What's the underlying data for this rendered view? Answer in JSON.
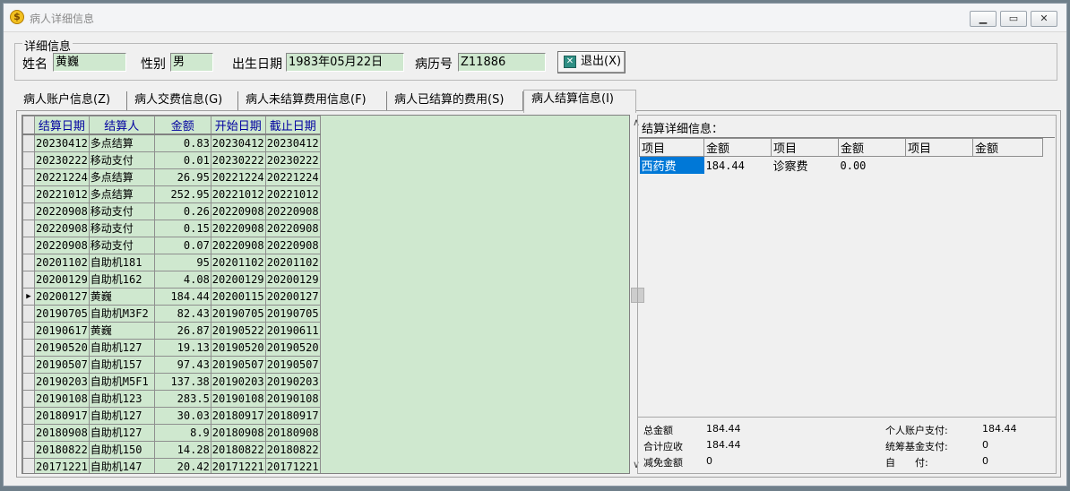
{
  "window": {
    "title": "病人详细信息"
  },
  "detail": {
    "legend": "详细信息",
    "name_label": "姓名",
    "name_value": "黄巍",
    "gender_label": "性别",
    "gender_value": "男",
    "dob_label": "出生日期",
    "dob_value": "1983年05月22日",
    "record_label": "病历号",
    "record_value": "Z11886",
    "exit_label": "退出(X)"
  },
  "tabs": [
    {
      "label": "病人账户信息(Z)"
    },
    {
      "label": "病人交费信息(G)"
    },
    {
      "label": "病人未结算费用信息(F)"
    },
    {
      "label": "病人已结算的费用(S)"
    },
    {
      "label": "病人结算信息(I)"
    }
  ],
  "grid": {
    "headers": [
      "结算日期",
      "结算人",
      "金额",
      "开始日期",
      "截止日期"
    ],
    "current_row": 9,
    "rows": [
      [
        "20230412",
        "多点结算",
        "0.83",
        "20230412",
        "20230412"
      ],
      [
        "20230222",
        "移动支付",
        "0.01",
        "20230222",
        "20230222"
      ],
      [
        "20221224",
        "多点结算",
        "26.95",
        "20221224",
        "20221224"
      ],
      [
        "20221012",
        "多点结算",
        "252.95",
        "20221012",
        "20221012"
      ],
      [
        "20220908",
        "移动支付",
        "0.26",
        "20220908",
        "20220908"
      ],
      [
        "20220908",
        "移动支付",
        "0.15",
        "20220908",
        "20220908"
      ],
      [
        "20220908",
        "移动支付",
        "0.07",
        "20220908",
        "20220908"
      ],
      [
        "20201102",
        "自助机181",
        "95",
        "20201102",
        "20201102"
      ],
      [
        "20200129",
        "自助机162",
        "4.08",
        "20200129",
        "20200129"
      ],
      [
        "20200127",
        "黄巍",
        "184.44",
        "20200115",
        "20200127"
      ],
      [
        "20190705",
        "自助机M3F2",
        "82.43",
        "20190705",
        "20190705"
      ],
      [
        "20190617",
        "黄巍",
        "26.87",
        "20190522",
        "20190611"
      ],
      [
        "20190520",
        "自助机127",
        "19.13",
        "20190520",
        "20190520"
      ],
      [
        "20190507",
        "自助机157",
        "97.43",
        "20190507",
        "20190507"
      ],
      [
        "20190203",
        "自助机M5F1",
        "137.38",
        "20190203",
        "20190203"
      ],
      [
        "20190108",
        "自助机123",
        "283.5",
        "20190108",
        "20190108"
      ],
      [
        "20180917",
        "自助机127",
        "30.03",
        "20180917",
        "20180917"
      ],
      [
        "20180908",
        "自助机127",
        "8.9",
        "20180908",
        "20180908"
      ],
      [
        "20180822",
        "自助机150",
        "14.28",
        "20180822",
        "20180822"
      ],
      [
        "20171221",
        "自助机147",
        "20.42",
        "20171221",
        "20171221"
      ]
    ]
  },
  "settlement": {
    "title": "结算详细信息：",
    "headers": [
      "项目",
      "金额",
      "项目",
      "金额",
      "项目",
      "金额"
    ],
    "row": [
      "西药费",
      "184.44",
      "诊察费",
      "0.00",
      "",
      ""
    ]
  },
  "summary": {
    "total_label": "总金额",
    "total_value": "184.44",
    "receivable_label": "合计应收",
    "receivable_value": "184.44",
    "discount_label": "减免金额",
    "discount_value": "0",
    "personal_label": "个人账户支付:",
    "personal_value": "184.44",
    "fund_label": "统筹基金支付:",
    "fund_value": "0",
    "self_label": "自　　付:",
    "self_value": "0"
  }
}
